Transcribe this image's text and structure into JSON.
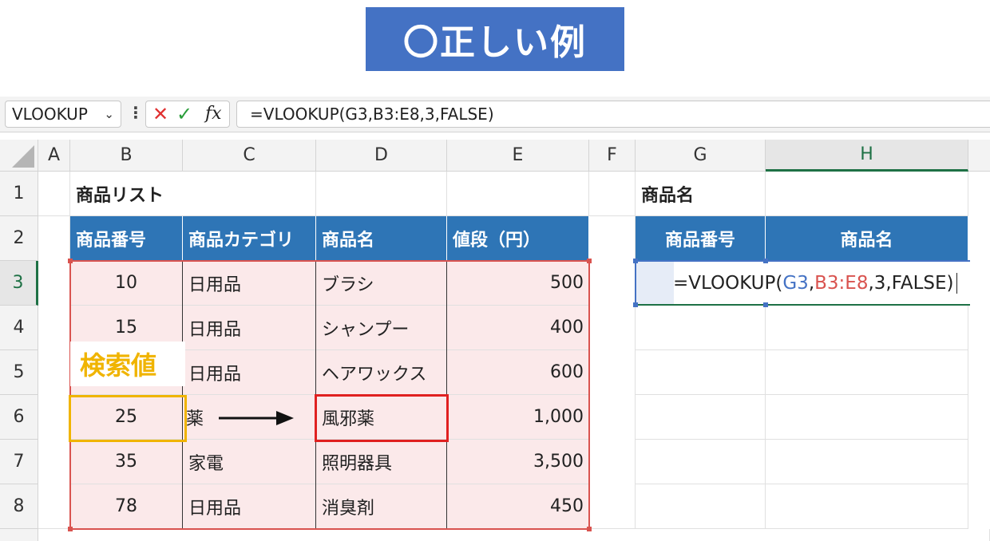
{
  "title": "〇正しい例",
  "formula_bar": {
    "name_box": "VLOOKUP",
    "chevron": "⌄",
    "dots": "⋮",
    "cancel_glyph": "✕",
    "enter_glyph": "✓",
    "fx_label": "fx",
    "formula": "=VLOOKUP(G3,B3:E8,3,FALSE)"
  },
  "columns": [
    "A",
    "B",
    "C",
    "D",
    "E",
    "F",
    "G",
    "H"
  ],
  "rows": [
    "1",
    "2",
    "3",
    "4",
    "5",
    "6",
    "7",
    "8"
  ],
  "sheet": {
    "list_title": "商品リスト",
    "headers": [
      "商品番号",
      "商品カテゴリ",
      "商品名",
      "値段（円）"
    ],
    "table": [
      [
        "10",
        "日用品",
        "ブラシ",
        "500"
      ],
      [
        "15",
        "日用品",
        "シャンプー",
        "400"
      ],
      [
        "",
        "日用品",
        "ヘアワックス",
        "600"
      ],
      [
        "25",
        "薬",
        "風邪薬",
        "1,000"
      ],
      [
        "35",
        "家電",
        "照明器具",
        "3,500"
      ],
      [
        "78",
        "日用品",
        "消臭剤",
        "450"
      ]
    ],
    "lookup_title": "商品名",
    "lookup_headers": [
      "商品番号",
      "商品名"
    ],
    "editing_formula": {
      "prefix": "=VLOOKUP(",
      "ref1": "G3",
      "sep1": ",",
      "ref2": "B3:E8",
      "rest": ",3,FALSE)"
    }
  },
  "callout": "検索値",
  "colors": {
    "header_blue": "#2e75b6",
    "range_pink": "#fbe9ea",
    "range_red": "#d9534f",
    "lookup_yellow": "#f0b400",
    "result_red": "#e02020",
    "title_blue": "#4472c4"
  }
}
